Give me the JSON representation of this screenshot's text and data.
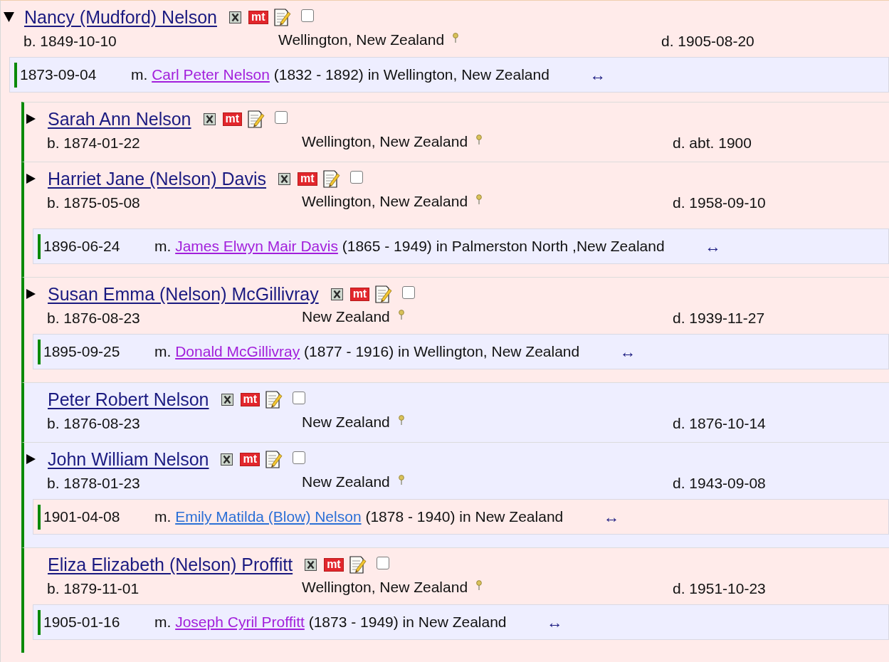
{
  "person": {
    "name": "Nancy (Mudford) Nelson",
    "expanded": true,
    "badge": "mt",
    "checked": false,
    "birth": "b. 1849-10-10",
    "place": "Wellington, New Zealand",
    "death": "d. 1905-08-20",
    "color": "#ffebea",
    "marriages": [
      {
        "date": "1873-09-04",
        "prefix": "m.",
        "spouse": "Carl Peter Nelson",
        "spouse_visited": true,
        "detail": "(1832 - 1892) in Wellington, New Zealand",
        "link": "↔",
        "color": "#eeeeff"
      }
    ],
    "children": [
      {
        "name": "Sarah Ann Nelson",
        "expanded": false,
        "badge": "mt",
        "checked": false,
        "birth": "b. 1874-01-22",
        "place": "Wellington, New Zealand",
        "death": "d. abt. 1900",
        "color": "#ffebea"
      },
      {
        "name": "Harriet Jane (Nelson) Davis",
        "expanded": false,
        "badge": "mt",
        "checked": false,
        "birth": "b. 1875-05-08",
        "place": "Wellington, New Zealand",
        "death": "d. 1958-09-10",
        "color": "#ffebea",
        "marriages": [
          {
            "date": "1896-06-24",
            "prefix": "m.",
            "spouse": "James Elwyn Mair Davis",
            "spouse_visited": true,
            "detail": "(1865 - 1949) in Palmerston North ,New Zealand",
            "link": "↔",
            "color": "#eeeeff"
          }
        ]
      },
      {
        "name": "Susan Emma (Nelson) McGillivray",
        "expanded": false,
        "badge": "mt",
        "checked": false,
        "birth": "b. 1876-08-23",
        "place": "New Zealand",
        "death": "d. 1939-11-27",
        "color": "#ffebea",
        "marriages": [
          {
            "date": "1895-09-25",
            "prefix": "m.",
            "spouse": "Donald McGillivray",
            "spouse_visited": true,
            "detail": "(1877 - 1916) in Wellington, New Zealand",
            "link": "↔",
            "color": "#eeeeff"
          }
        ]
      },
      {
        "name": "Peter Robert Nelson",
        "badge": "mt",
        "checked": false,
        "birth": "b. 1876-08-23",
        "place": "New Zealand",
        "death": "d. 1876-10-14",
        "color": "#eeeeff"
      },
      {
        "name": "John William Nelson",
        "expanded": false,
        "badge": "mt",
        "checked": false,
        "birth": "b. 1878-01-23",
        "place": "New Zealand",
        "death": "d. 1943-09-08",
        "color": "#eeeeff",
        "marriages": [
          {
            "date": "1901-04-08",
            "prefix": "m.",
            "spouse": "Emily Matilda (Blow) Nelson",
            "spouse_visited": false,
            "detail": "(1878 - 1940) in New Zealand",
            "link": "↔",
            "color": "#ffebea"
          }
        ]
      },
      {
        "name": "Eliza Elizabeth (Nelson) Proffitt",
        "badge": "mt",
        "checked": false,
        "birth": "b. 1879-11-01",
        "place": "Wellington, New Zealand",
        "death": "d. 1951-10-23",
        "color": "#ffebea",
        "marriages": [
          {
            "date": "1905-01-16",
            "prefix": "m.",
            "spouse": "Joseph Cyril Proffitt",
            "spouse_visited": true,
            "detail": "(1873 - 1949) in New Zealand",
            "link": "↔",
            "color": "#eeeeff"
          }
        ]
      }
    ]
  }
}
